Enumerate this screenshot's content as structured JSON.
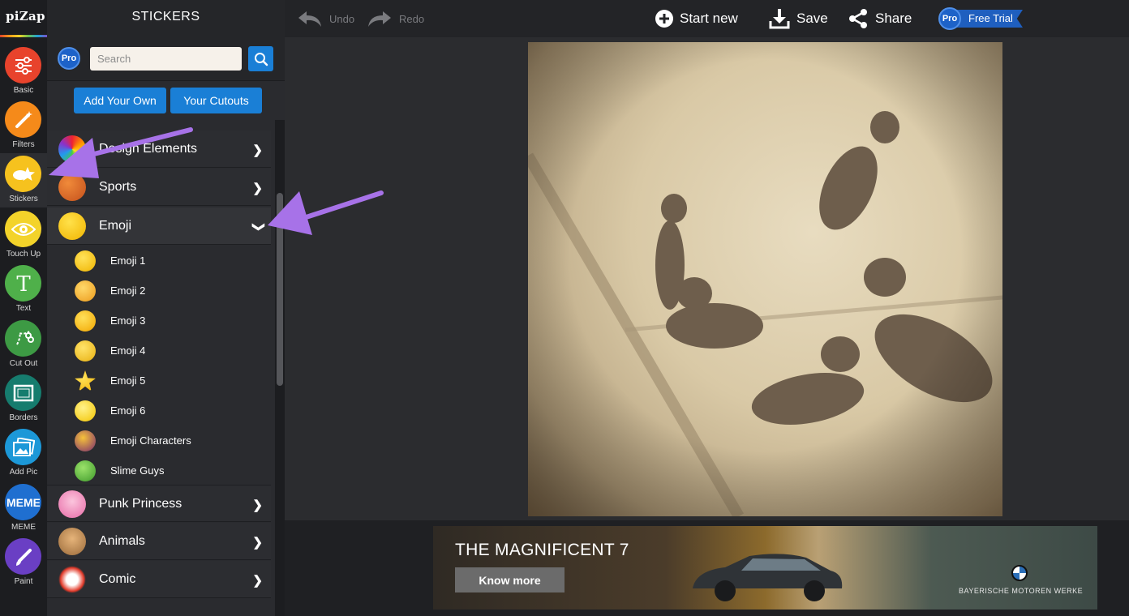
{
  "app": {
    "logo": "piZap"
  },
  "rail": {
    "tools": [
      {
        "label": "Basic",
        "icon": "sliders-icon",
        "color": "#e8432c"
      },
      {
        "label": "Filters",
        "icon": "magic-wand-icon",
        "color": "#f58a1a"
      },
      {
        "label": "Stickers",
        "icon": "sticker-star-icon",
        "color": "#f6c21e"
      },
      {
        "label": "Touch Up",
        "icon": "eye-icon",
        "color": "#f3d32a"
      },
      {
        "label": "Text",
        "icon": "text-t-icon",
        "color": "#4fb04a"
      },
      {
        "label": "Cut Out",
        "icon": "cutout-scissors-icon",
        "color": "#3d9a44"
      },
      {
        "label": "Borders",
        "icon": "border-frame-icon",
        "color": "#167c6e"
      },
      {
        "label": "Add Pic",
        "icon": "add-picture-icon",
        "color": "#1c98d8"
      },
      {
        "label": "MEME",
        "icon": "meme-icon",
        "color": "#1f6fd0"
      },
      {
        "label": "Paint",
        "icon": "paint-brush-icon",
        "color": "#6a3fc4"
      }
    ]
  },
  "panel": {
    "title": "STICKERS",
    "pro_badge": "Pro",
    "search_placeholder": "Search",
    "add_your_own": "Add Your Own",
    "your_cutouts": "Your Cutouts",
    "categories_top": [
      {
        "name": "Design Elements",
        "icon": "rainbow-icon"
      },
      {
        "name": "Sports",
        "icon": "basketball-icon"
      }
    ],
    "open_category": {
      "name": "Emoji",
      "icon": "emoji-face-icon"
    },
    "subcategories": [
      "Emoji 1",
      "Emoji 2",
      "Emoji 3",
      "Emoji 4",
      "Emoji 5",
      "Emoji 6",
      "Emoji Characters",
      "Slime Guys"
    ],
    "categories_bottom": [
      {
        "name": "Punk Princess",
        "icon": "skull-icon"
      },
      {
        "name": "Animals",
        "icon": "dog-icon"
      },
      {
        "name": "Comic",
        "icon": "comic-burst-icon"
      }
    ]
  },
  "toolbar": {
    "undo": "Undo",
    "redo": "Redo",
    "start_new": "Start new",
    "save": "Save",
    "share": "Share",
    "pro": "Pro",
    "free_trial": "Free Trial"
  },
  "ad": {
    "headline": "THE MAGNIFICENT 7",
    "cta": "Know more",
    "brand": "BAYERISCHE  MOTOREN  WERKE",
    "help": "?"
  }
}
